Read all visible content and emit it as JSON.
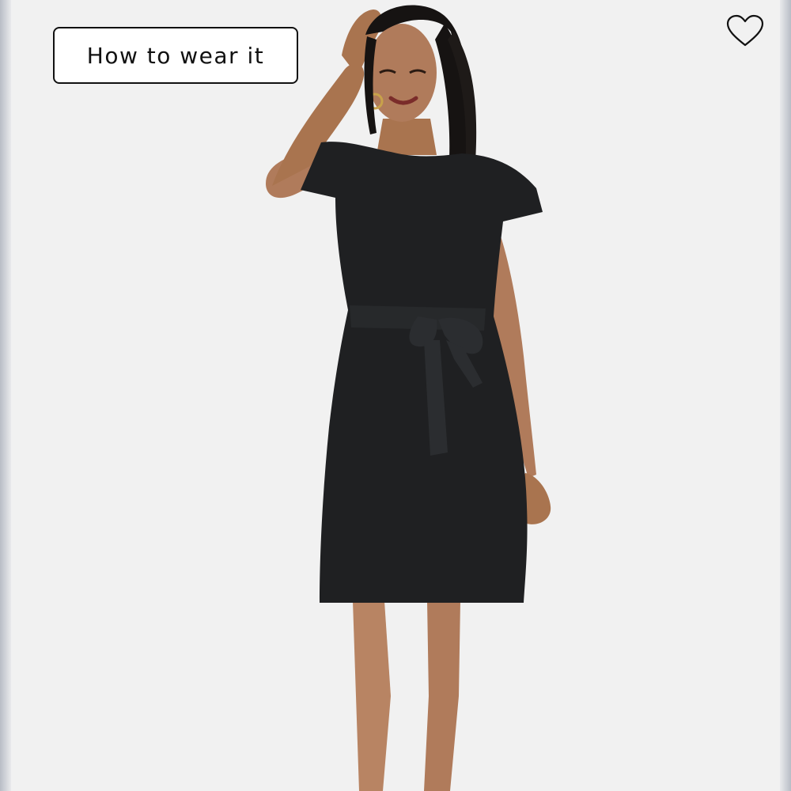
{
  "product_image": {
    "subject": "model-in-black-tie-waist-tshirt-dress",
    "background_color": "#f1f1f1",
    "dress_color": "#1f2022"
  },
  "how_to_wear": {
    "label": "How to wear it",
    "icon": "none"
  },
  "favorite": {
    "icon": "heart-outline-icon",
    "active": false
  },
  "colors": {
    "accent": "#111111",
    "button_background": "#ffffff"
  }
}
